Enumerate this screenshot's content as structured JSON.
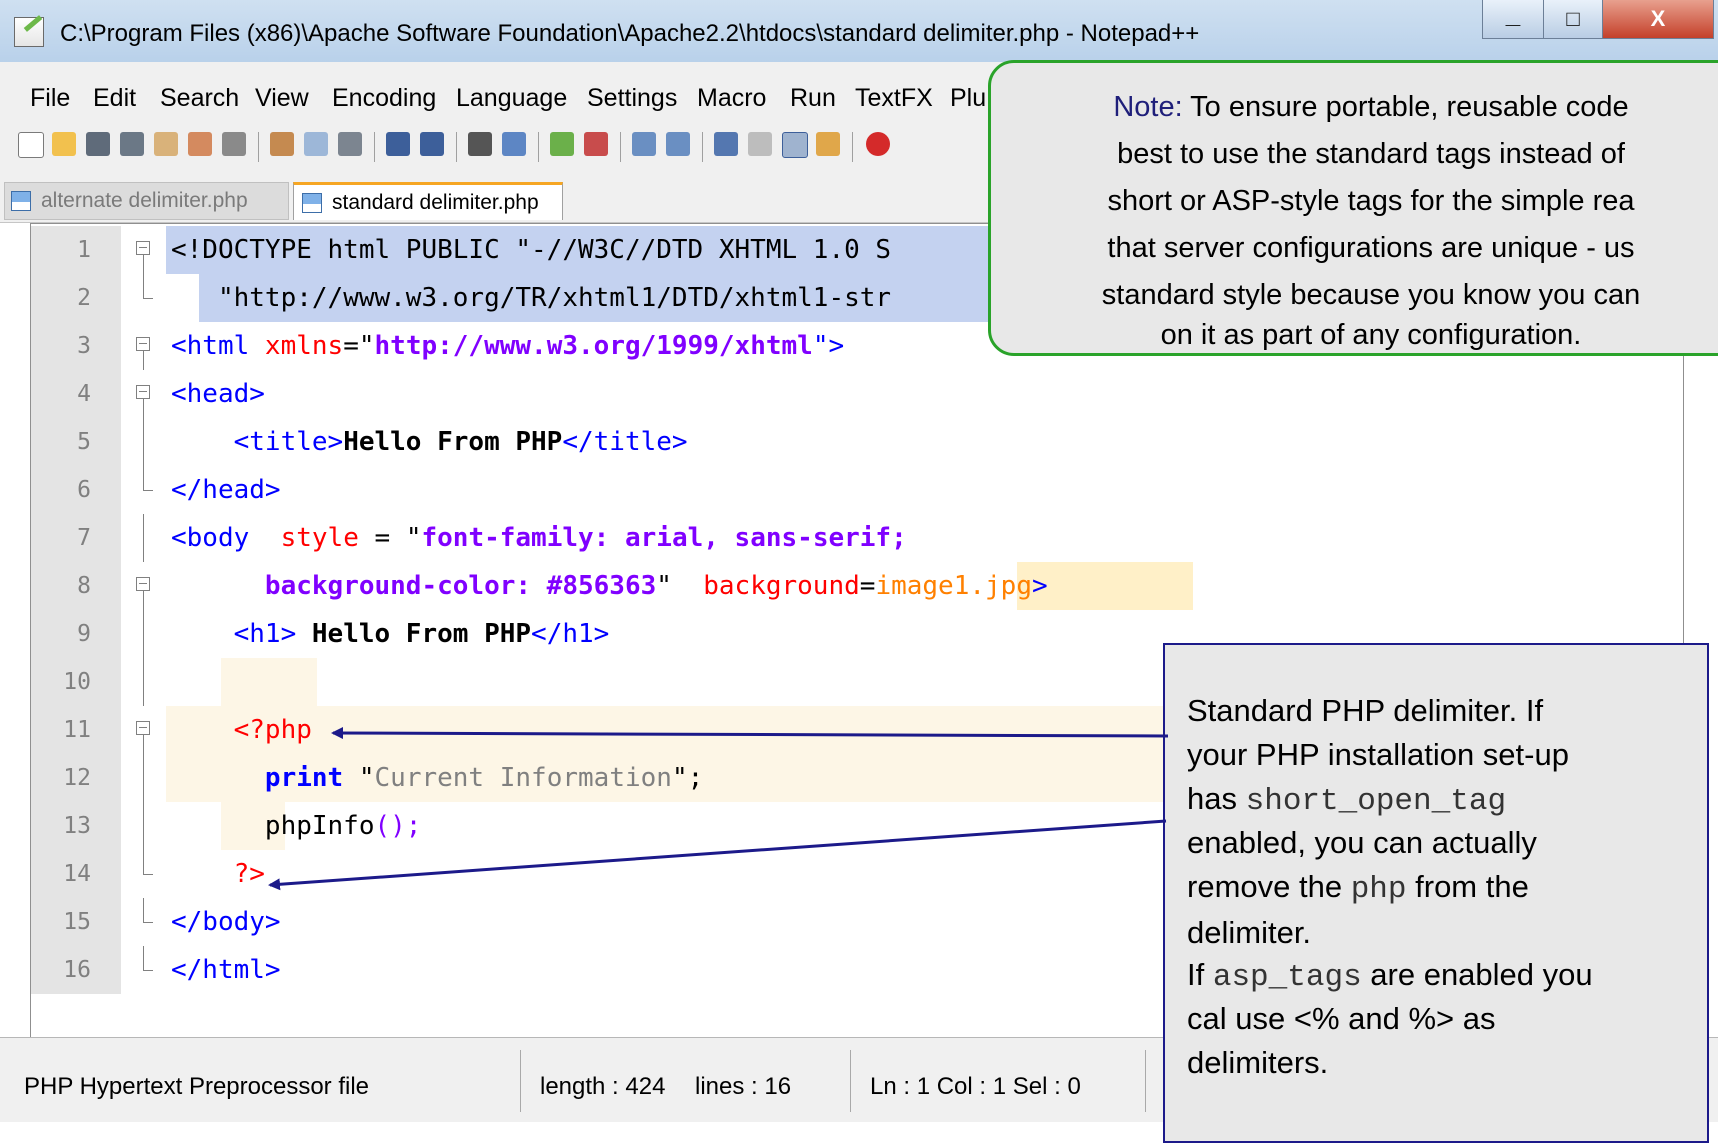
{
  "window": {
    "title": "C:\\Program Files (x86)\\Apache Software Foundation\\Apache2.2\\htdocs\\standard delimiter.php - Notepad++",
    "minimize_label": "_",
    "maximize_label": "□",
    "close_label": "X"
  },
  "menu": {
    "items": [
      "File",
      "Edit",
      "Search",
      "View",
      "Encoding",
      "Language",
      "Settings",
      "Macro",
      "Run",
      "TextFX",
      "Plu"
    ]
  },
  "tabs": [
    {
      "label": "alternate delimiter.php",
      "active": false
    },
    {
      "label": "standard delimiter.php",
      "active": true
    }
  ],
  "editor": {
    "lines": [
      {
        "num": "1",
        "tokens": [
          {
            "t": "<!DOCTYPE html PUBLIC \"-//W3C//DTD XHTML 1.0 S",
            "c": "#000000",
            "b": false
          }
        ]
      },
      {
        "num": "2",
        "tokens": [
          {
            "t": "   \"",
            "c": "#000000",
            "b": false
          },
          {
            "t": "http://www.w3.org/TR/xhtml1/DTD/xhtml1-str",
            "c": "#000000",
            "b": false
          }
        ]
      },
      {
        "num": "3",
        "tokens": [
          {
            "t": "<html ",
            "c": "#0000ff",
            "b": false
          },
          {
            "t": "xmlns",
            "c": "#ff0000",
            "b": false
          },
          {
            "t": "=\"",
            "c": "#000000",
            "b": false
          },
          {
            "t": "http://www.w3.org/1999/xhtml",
            "c": "#8000ff",
            "b": true
          },
          {
            "t": "\">",
            "c": "#0000ff",
            "b": false
          }
        ]
      },
      {
        "num": "4",
        "tokens": [
          {
            "t": "<head>",
            "c": "#0000ff",
            "b": false
          }
        ]
      },
      {
        "num": "5",
        "tokens": [
          {
            "t": "    <title>",
            "c": "#0000ff",
            "b": false
          },
          {
            "t": "Hello From PHP",
            "c": "#000000",
            "b": true
          },
          {
            "t": "</title>",
            "c": "#0000ff",
            "b": false
          }
        ]
      },
      {
        "num": "6",
        "tokens": [
          {
            "t": "</head>",
            "c": "#0000ff",
            "b": false
          }
        ]
      },
      {
        "num": "7",
        "tokens": [
          {
            "t": "<body  ",
            "c": "#0000ff",
            "b": false
          },
          {
            "t": "style",
            "c": "#ff0000",
            "b": false
          },
          {
            "t": " = \"",
            "c": "#000000",
            "b": false
          },
          {
            "t": "font-family: arial, sans-serif;",
            "c": "#8000ff",
            "b": true
          }
        ]
      },
      {
        "num": "8",
        "tokens": [
          {
            "t": "      ",
            "c": "#000000",
            "b": false
          },
          {
            "t": "background-color: #856363",
            "c": "#8000ff",
            "b": true
          },
          {
            "t": "\"  ",
            "c": "#000000",
            "b": false
          },
          {
            "t": "background",
            "c": "#ff0000",
            "b": false
          },
          {
            "t": "=",
            "c": "#000000",
            "b": false
          },
          {
            "t": "image1.jpg",
            "c": "#ff8000",
            "b": false
          },
          {
            "t": ">",
            "c": "#0000ff",
            "b": false
          }
        ]
      },
      {
        "num": "9",
        "tokens": [
          {
            "t": "    <h1> ",
            "c": "#0000ff",
            "b": false
          },
          {
            "t": "Hello From PHP",
            "c": "#000000",
            "b": true
          },
          {
            "t": "</h1>",
            "c": "#0000ff",
            "b": false
          }
        ]
      },
      {
        "num": "10",
        "tokens": []
      },
      {
        "num": "11",
        "tokens": [
          {
            "t": "    ",
            "c": "#000000",
            "b": false
          },
          {
            "t": "<?php",
            "c": "#ff0000",
            "b": false
          }
        ]
      },
      {
        "num": "12",
        "tokens": [
          {
            "t": "      ",
            "c": "#000000",
            "b": false
          },
          {
            "t": "print",
            "c": "#0000ff",
            "b": true
          },
          {
            "t": " \"",
            "c": "#000000",
            "b": false
          },
          {
            "t": "Current Information",
            "c": "#808080",
            "b": false
          },
          {
            "t": "\";",
            "c": "#000000",
            "b": false
          }
        ]
      },
      {
        "num": "13",
        "tokens": [
          {
            "t": "      phpInfo",
            "c": "#000000",
            "b": false
          },
          {
            "t": "();",
            "c": "#8000ff",
            "b": false
          }
        ]
      },
      {
        "num": "14",
        "tokens": [
          {
            "t": "    ",
            "c": "#000000",
            "b": false
          },
          {
            "t": "?>",
            "c": "#ff0000",
            "b": false
          }
        ]
      },
      {
        "num": "15",
        "tokens": [
          {
            "t": "</body>",
            "c": "#0000ff",
            "b": false
          }
        ]
      },
      {
        "num": "16",
        "tokens": [
          {
            "t": "</html>",
            "c": "#0000ff",
            "b": false
          }
        ]
      }
    ]
  },
  "status": {
    "file_type": "PHP Hypertext Preprocessor file",
    "length": "length : 424",
    "lines": "lines : 16",
    "position": "Ln : 1   Col : 1   Sel : 0"
  },
  "note": {
    "label": "Note:",
    "line1": " To ensure portable, reusable code",
    "line2": "best to use the standard tags instead of",
    "line3": "short or ASP-style tags for the simple rea",
    "line4": "that server configurations are unique  - us",
    "line5": "standard style because you know you can",
    "line6": "on it as part of any configuration."
  },
  "callout": {
    "l1": "Standard PHP delimiter.  If",
    "l2": "your PHP installation set-up",
    "l3a": "has ",
    "l3b": "short_open_tag",
    "l4": "enabled, you can actually",
    "l5a": "remove the ",
    "l5b": "php",
    "l5c": " from the",
    "l6": "delimiter.",
    "l7a": "If ",
    "l7b": "asp_tags",
    "l7c": " are enabled you",
    "l8": "cal use <% and %> as",
    "l9": "delimiters."
  },
  "colors": {
    "note_border": "#2aa32a",
    "callout_border": "#1c1a8a",
    "arrow": "#1c1a8a"
  }
}
